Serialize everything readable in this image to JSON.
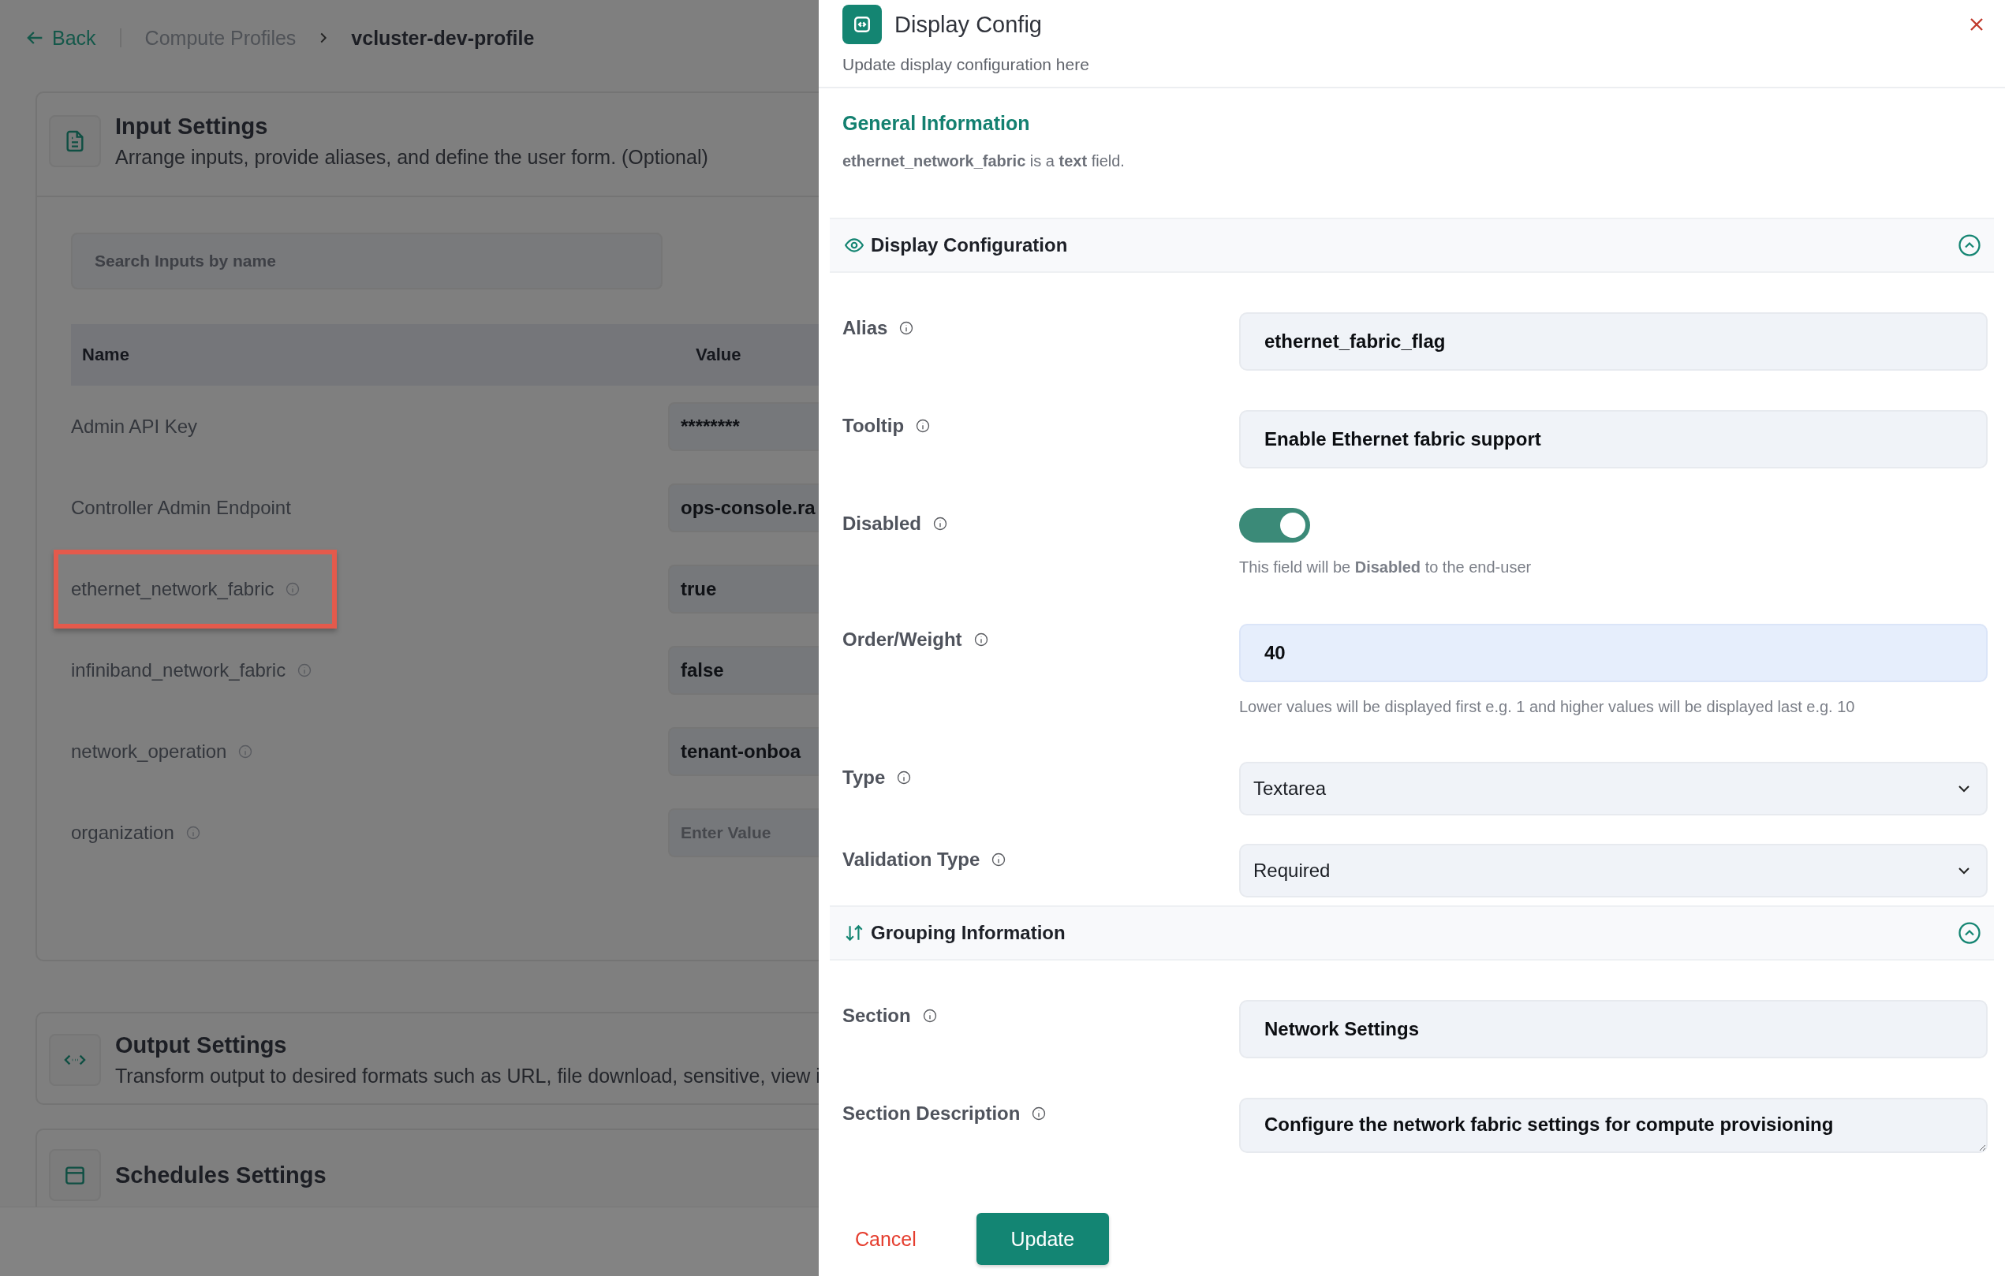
{
  "breadcrumb": {
    "back": "Back",
    "items": [
      {
        "label": "Compute Profiles",
        "current": false
      },
      {
        "label": "vcluster-dev-profile",
        "current": true
      }
    ]
  },
  "input_settings": {
    "title": "Input Settings",
    "description": "Arrange inputs, provide aliases, and define the user form. (Optional)",
    "search": {
      "placeholder": "Search Inputs by name"
    },
    "table": {
      "columns": [
        "Name",
        "Value"
      ],
      "rows": [
        {
          "name": "Admin API Key",
          "info": false,
          "highlighted": false,
          "value": "********"
        },
        {
          "name": "Controller Admin Endpoint",
          "info": false,
          "highlighted": false,
          "value": "ops-console.ra"
        },
        {
          "name": "ethernet_network_fabric",
          "info": true,
          "highlighted": true,
          "value": "true"
        },
        {
          "name": "infiniband_network_fabric",
          "info": true,
          "highlighted": false,
          "value": "false"
        },
        {
          "name": "network_operation",
          "info": true,
          "highlighted": false,
          "value": "tenant-onboa"
        },
        {
          "name": "organization",
          "info": true,
          "highlighted": false,
          "placeholder": "Enter Value"
        }
      ]
    }
  },
  "output_settings": {
    "title": "Output Settings",
    "description": "Transform output to desired formats such as URL, file download, sensitive, view i"
  },
  "schedules_settings": {
    "title": "Schedules Settings"
  },
  "drawer": {
    "title": "Display Config",
    "subtitle": "Update display configuration here",
    "general": {
      "heading": "General Information",
      "description": "**ethernet_network_fabric** is a **text** field."
    },
    "sections": [
      {
        "title": "Display Configuration",
        "expanded": true,
        "fields": [
          {
            "label": "Alias",
            "kind": "input",
            "value": "ethernet_fabric_flag",
            "focused": false
          },
          {
            "label": "Tooltip",
            "kind": "input",
            "value": "Enable Ethernet fabric support",
            "focused": false
          },
          {
            "label": "Disabled",
            "kind": "toggle",
            "on": true,
            "helper": "This field will be **Disabled** to the end-user"
          },
          {
            "label": "Order/Weight",
            "kind": "input",
            "value": "40",
            "focused": true,
            "helper": "Lower values will be displayed first e.g. 1 and higher values will be displayed last e.g. 10"
          },
          {
            "label": "Type",
            "kind": "select",
            "value": "Textarea"
          },
          {
            "label": "Validation Type",
            "kind": "select",
            "value": "Required"
          }
        ]
      },
      {
        "title": "Grouping Information",
        "expanded": true,
        "fields": [
          {
            "label": "Section",
            "kind": "input",
            "value": "Network Settings",
            "focused": false
          },
          {
            "label": "Section Description",
            "kind": "textarea",
            "value": "Configure the network fabric settings for compute provisioning"
          }
        ]
      }
    ],
    "buttons": {
      "cancel": "Cancel",
      "submit": "Update"
    }
  }
}
